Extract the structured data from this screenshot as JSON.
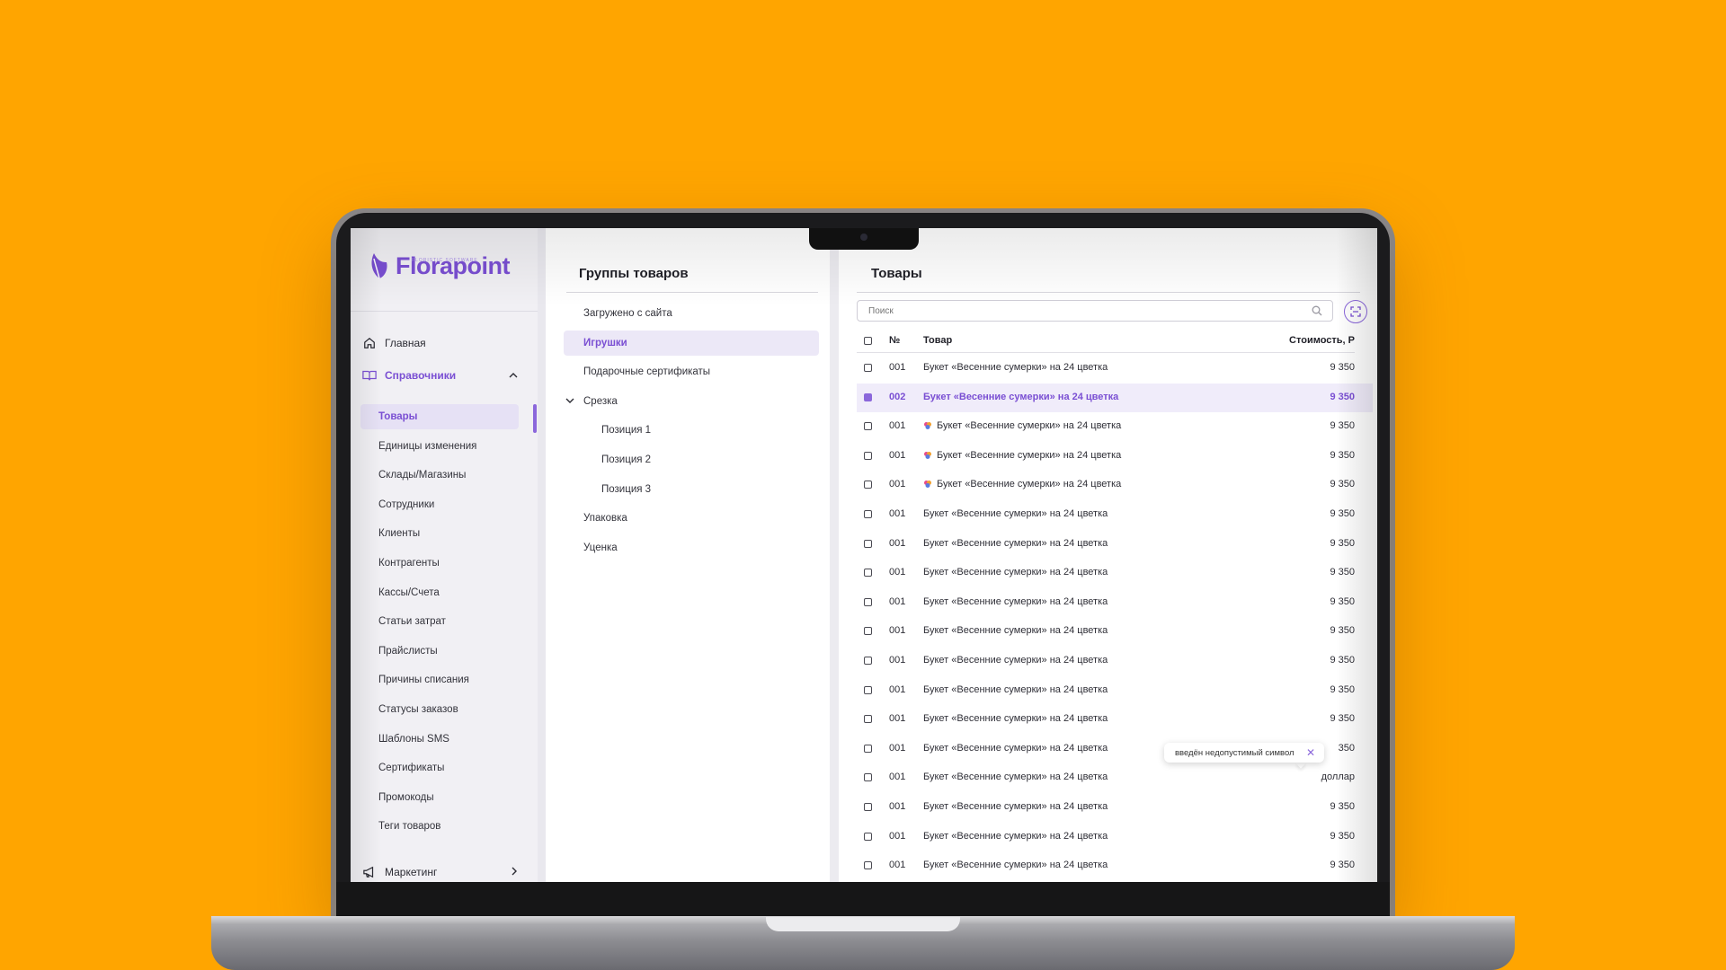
{
  "app": {
    "logo_text": "Florapoint",
    "logo_sub": "FLORISTIC SOFTWARE",
    "brand_color": "#7a4fd3"
  },
  "sidebar": {
    "top_items": [
      {
        "label": "Главная",
        "icon": "home-icon"
      },
      {
        "label": "Справочники",
        "icon": "book-icon",
        "expanded": true
      }
    ],
    "sub_items": [
      "Товары",
      "Единицы изменения",
      "Склады/Магазины",
      "Сотрудники",
      "Клиенты",
      "Контрагенты",
      "Кассы/Счета",
      "Статьи затрат",
      "Прайслисты",
      "Причины списания",
      "Статусы заказов",
      "Шаблоны SMS",
      "Сертификаты",
      "Промокоды",
      "Теги товаров"
    ],
    "selected_sub": "Товары",
    "bottom_item": {
      "label": "Маркетинг",
      "icon": "megaphone-icon"
    }
  },
  "groups": {
    "title": "Группы товаров",
    "items": [
      {
        "label": "Загружено с сайта",
        "level": 0
      },
      {
        "label": "Игрушки",
        "level": 0,
        "selected": true
      },
      {
        "label": "Подарочные сертификаты",
        "level": 0
      },
      {
        "label": "Срезка",
        "level": 0,
        "expanded": true
      },
      {
        "label": "Позиция 1",
        "level": 1
      },
      {
        "label": "Позиция 2",
        "level": 1
      },
      {
        "label": "Позиция 3",
        "level": 1
      },
      {
        "label": "Упаковка",
        "level": 0
      },
      {
        "label": "Уценка",
        "level": 0
      }
    ]
  },
  "goods": {
    "title": "Товары",
    "search_placeholder": "Поиск",
    "columns": {
      "num": "№",
      "name": "Товар",
      "price": "Стоимость, Р"
    },
    "rows": [
      {
        "num": "001",
        "name": "Букет «Весенние сумерки» на 24 цветка",
        "price": "9 350",
        "icon": false,
        "checked": false
      },
      {
        "num": "002",
        "name": "Букет «Весенние сумерки» на 24 цветка",
        "price": "9 350",
        "icon": false,
        "checked": true
      },
      {
        "num": "001",
        "name": "Букет «Весенние сумерки» на 24 цветка",
        "price": "9 350",
        "icon": true,
        "checked": false
      },
      {
        "num": "001",
        "name": "Букет «Весенние сумерки» на 24 цветка",
        "price": "9 350",
        "icon": true,
        "checked": false
      },
      {
        "num": "001",
        "name": "Букет «Весенние сумерки» на 24 цветка",
        "price": "9 350",
        "icon": true,
        "checked": false
      },
      {
        "num": "001",
        "name": "Букет «Весенние сумерки» на 24 цветка",
        "price": "9 350",
        "icon": false,
        "checked": false
      },
      {
        "num": "001",
        "name": "Букет «Весенние сумерки» на 24 цветка",
        "price": "9 350",
        "icon": false,
        "checked": false
      },
      {
        "num": "001",
        "name": "Букет «Весенние сумерки» на 24 цветка",
        "price": "9 350",
        "icon": false,
        "checked": false
      },
      {
        "num": "001",
        "name": "Букет «Весенние сумерки» на 24 цветка",
        "price": "9 350",
        "icon": false,
        "checked": false
      },
      {
        "num": "001",
        "name": "Букет «Весенние сумерки» на 24 цветка",
        "price": "9 350",
        "icon": false,
        "checked": false
      },
      {
        "num": "001",
        "name": "Букет «Весенние сумерки» на 24 цветка",
        "price": "9 350",
        "icon": false,
        "checked": false
      },
      {
        "num": "001",
        "name": "Букет «Весенние сумерки» на 24 цветка",
        "price": "9 350",
        "icon": false,
        "checked": false
      },
      {
        "num": "001",
        "name": "Букет «Весенние сумерки» на 24 цветка",
        "price": "9 350",
        "icon": false,
        "checked": false
      },
      {
        "num": "001",
        "name": "Букет «Весенние сумерки» на 24 цветка",
        "price": "350",
        "icon": false,
        "checked": false
      },
      {
        "num": "001",
        "name": "Букет «Весенние сумерки» на 24 цветка",
        "price": "доллар",
        "icon": false,
        "checked": false
      },
      {
        "num": "001",
        "name": "Букет «Весенние сумерки» на 24 цветка",
        "price": "9 350",
        "icon": false,
        "checked": false
      },
      {
        "num": "001",
        "name": "Букет «Весенние сумерки» на 24 цветка",
        "price": "9 350",
        "icon": false,
        "checked": false
      },
      {
        "num": "001",
        "name": "Букет «Весенние сумерки» на 24 цветка",
        "price": "9 350",
        "icon": false,
        "checked": false
      }
    ],
    "tooltip": "введён недопустимый символ"
  }
}
